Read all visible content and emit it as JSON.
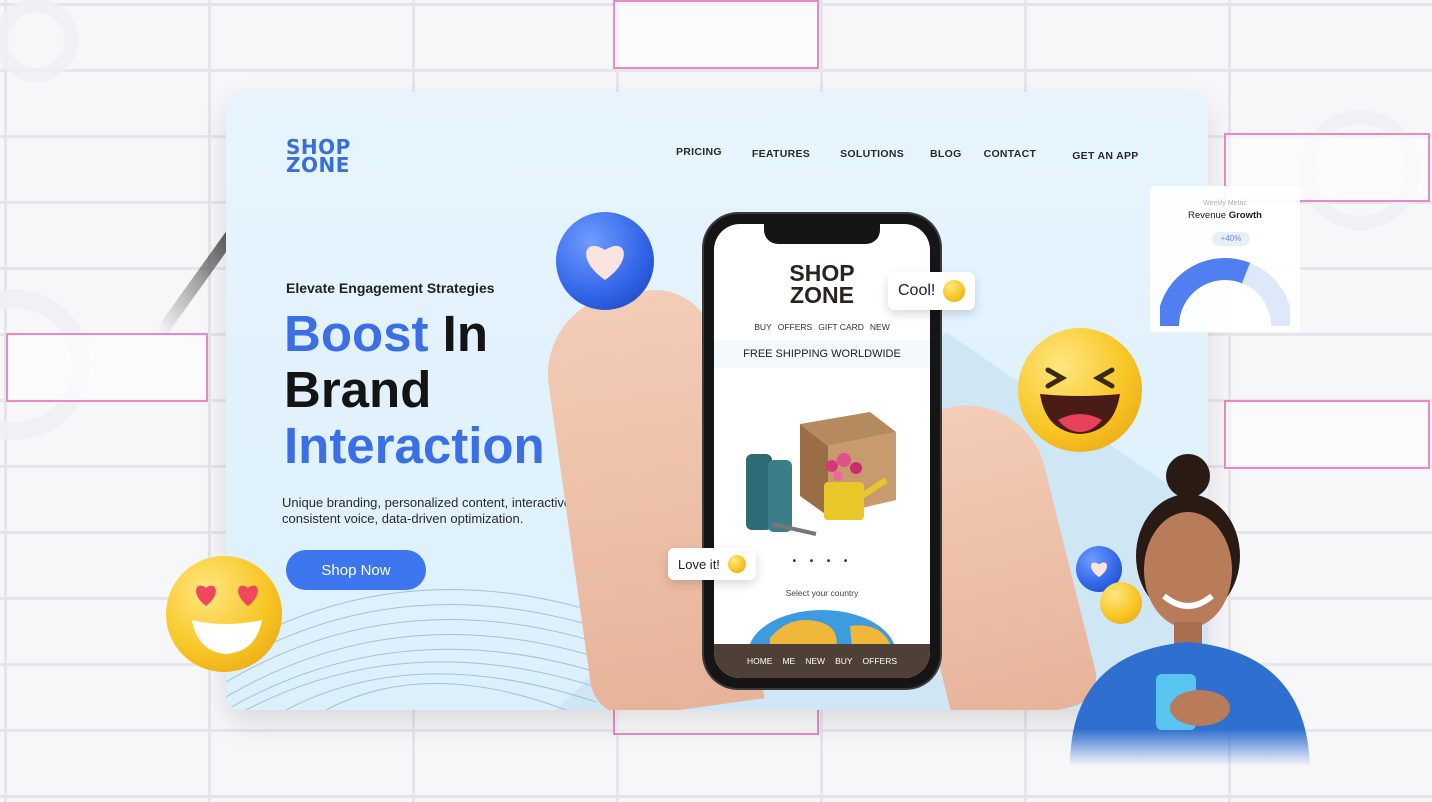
{
  "brand": {
    "line1": "SHOP",
    "line2": "ZONE"
  },
  "nav": [
    "PRICING",
    "FEATURES",
    "SOLUTIONS",
    "BLOG",
    "CONTACT",
    "GET AN APP"
  ],
  "hero": {
    "eyebrow": "Elevate Engagement Strategies",
    "headline_part1": "Boost",
    "headline_part2": "In",
    "headline_part3": "Brand",
    "headline_part4": "Interaction",
    "description": "Unique branding, personalized content, interactive, consistent voice, data-driven optimization.",
    "cta": "Shop Now"
  },
  "phone": {
    "logo_line1": "SHOP",
    "logo_line2": "ZONE",
    "menu": [
      "BUY",
      "OFFERS",
      "GIFT CARD",
      "NEW"
    ],
    "banner": "FREE SHIPPING WORLDWIDE",
    "dots": "• • • •",
    "select_country": "Select your country",
    "bottom_nav": [
      "HOME",
      "ME",
      "NEW",
      "BUY",
      "OFFERS"
    ]
  },
  "bubbles": {
    "cool": "Cool!",
    "love": "Love it!"
  },
  "revenue_widget": {
    "supertitle": "Weekly Metric",
    "title_normal": "Revenue",
    "title_bold": "Growth",
    "badge": "+40%",
    "progress": 0.62
  },
  "colors": {
    "accent": "#3b6fe6",
    "cta": "#3b76ef",
    "pink_border": "#e88ac8"
  },
  "icons": [
    "heart-orb-icon",
    "laughing-emoji-icon",
    "heart-eyes-emoji-icon",
    "wink-emoji-icon",
    "smile-emoji-icon"
  ]
}
